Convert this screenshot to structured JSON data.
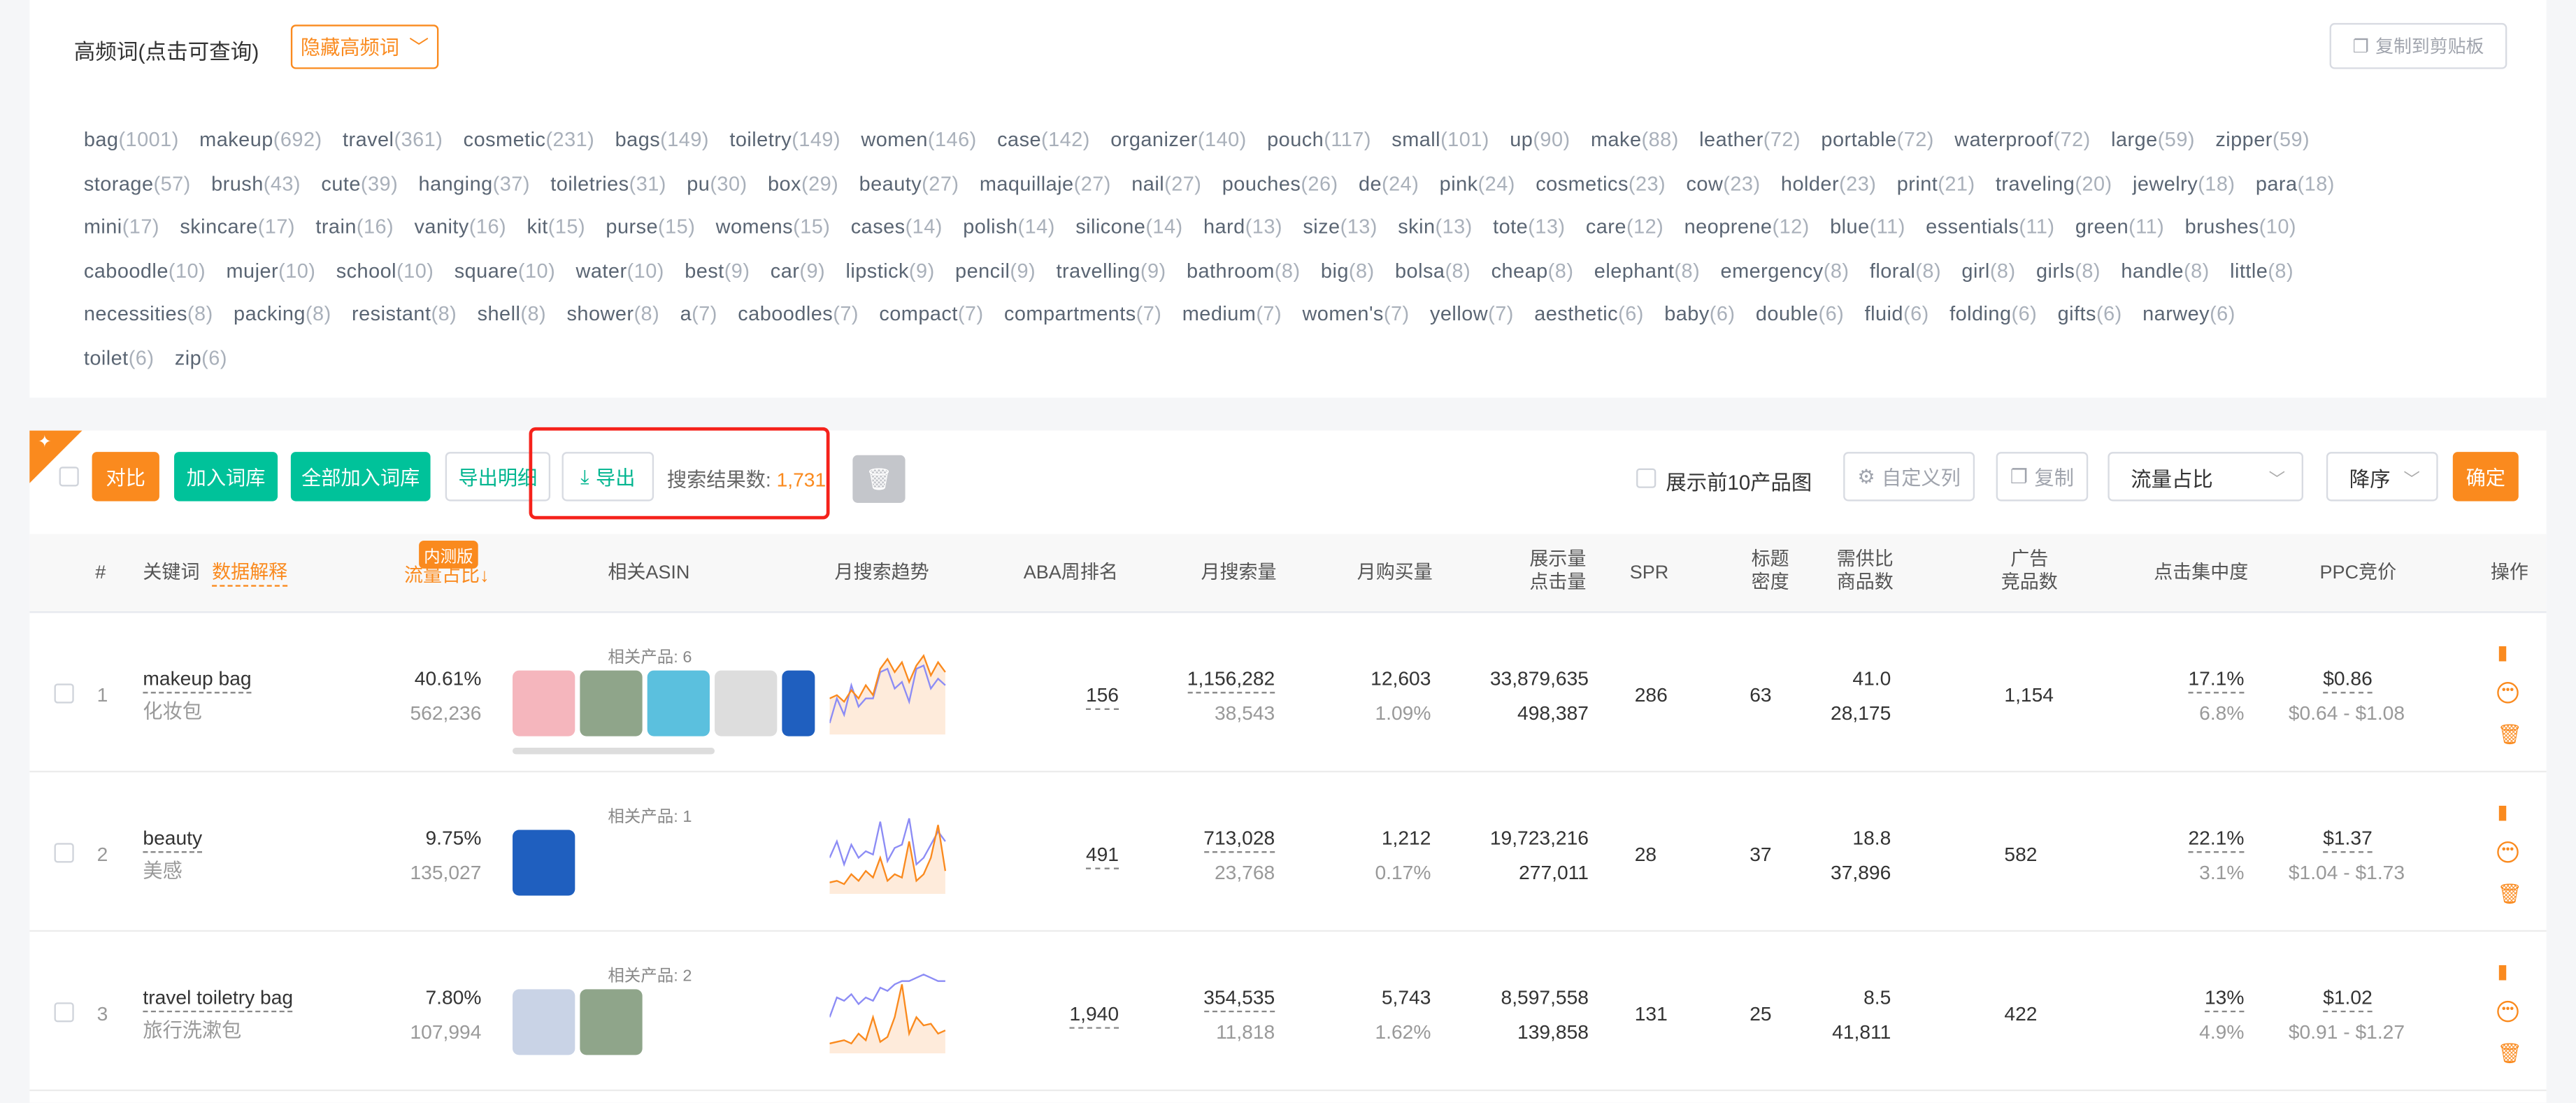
{
  "hf": {
    "title": "高频词(点击可查询)",
    "toggle_label": "隐藏高频词",
    "copy_label": "复制到剪贴板",
    "rows": [
      [
        [
          "bag",
          "1001"
        ],
        [
          "makeup",
          "692"
        ],
        [
          "travel",
          "361"
        ],
        [
          "cosmetic",
          "231"
        ],
        [
          "bags",
          "149"
        ],
        [
          "toiletry",
          "149"
        ],
        [
          "women",
          "146"
        ],
        [
          "case",
          "142"
        ],
        [
          "organizer",
          "140"
        ],
        [
          "pouch",
          "117"
        ],
        [
          "small",
          "101"
        ],
        [
          "up",
          "90"
        ],
        [
          "make",
          "88"
        ],
        [
          "leather",
          "72"
        ],
        [
          "portable",
          "72"
        ],
        [
          "waterproof",
          "72"
        ],
        [
          "large",
          "59"
        ],
        [
          "zipper",
          "59"
        ]
      ],
      [
        [
          "storage",
          "57"
        ],
        [
          "brush",
          "43"
        ],
        [
          "cute",
          "39"
        ],
        [
          "hanging",
          "37"
        ],
        [
          "toiletries",
          "31"
        ],
        [
          "pu",
          "30"
        ],
        [
          "box",
          "29"
        ],
        [
          "beauty",
          "27"
        ],
        [
          "maquillaje",
          "27"
        ],
        [
          "nail",
          "27"
        ],
        [
          "pouches",
          "26"
        ],
        [
          "de",
          "24"
        ],
        [
          "pink",
          "24"
        ],
        [
          "cosmetics",
          "23"
        ],
        [
          "cow",
          "23"
        ],
        [
          "holder",
          "23"
        ],
        [
          "print",
          "21"
        ],
        [
          "traveling",
          "20"
        ],
        [
          "jewelry",
          "18"
        ],
        [
          "para",
          "18"
        ]
      ],
      [
        [
          "mini",
          "17"
        ],
        [
          "skincare",
          "17"
        ],
        [
          "train",
          "16"
        ],
        [
          "vanity",
          "16"
        ],
        [
          "kit",
          "15"
        ],
        [
          "purse",
          "15"
        ],
        [
          "womens",
          "15"
        ],
        [
          "cases",
          "14"
        ],
        [
          "polish",
          "14"
        ],
        [
          "silicone",
          "14"
        ],
        [
          "hard",
          "13"
        ],
        [
          "size",
          "13"
        ],
        [
          "skin",
          "13"
        ],
        [
          "tote",
          "13"
        ],
        [
          "care",
          "12"
        ],
        [
          "neoprene",
          "12"
        ],
        [
          "blue",
          "11"
        ],
        [
          "essentials",
          "11"
        ],
        [
          "green",
          "11"
        ],
        [
          "brushes",
          "10"
        ]
      ],
      [
        [
          "caboodle",
          "10"
        ],
        [
          "mujer",
          "10"
        ],
        [
          "school",
          "10"
        ],
        [
          "square",
          "10"
        ],
        [
          "water",
          "10"
        ],
        [
          "best",
          "9"
        ],
        [
          "car",
          "9"
        ],
        [
          "lipstick",
          "9"
        ],
        [
          "pencil",
          "9"
        ],
        [
          "travelling",
          "9"
        ],
        [
          "bathroom",
          "8"
        ],
        [
          "big",
          "8"
        ],
        [
          "bolsa",
          "8"
        ],
        [
          "cheap",
          "8"
        ],
        [
          "elephant",
          "8"
        ],
        [
          "emergency",
          "8"
        ],
        [
          "floral",
          "8"
        ],
        [
          "girl",
          "8"
        ],
        [
          "girls",
          "8"
        ],
        [
          "handle",
          "8"
        ],
        [
          "little",
          "8"
        ]
      ],
      [
        [
          "necessities",
          "8"
        ],
        [
          "packing",
          "8"
        ],
        [
          "resistant",
          "8"
        ],
        [
          "shell",
          "8"
        ],
        [
          "shower",
          "8"
        ],
        [
          "a",
          "7"
        ],
        [
          "caboodles",
          "7"
        ],
        [
          "compact",
          "7"
        ],
        [
          "compartments",
          "7"
        ],
        [
          "medium",
          "7"
        ],
        [
          "women's",
          "7"
        ],
        [
          "yellow",
          "7"
        ],
        [
          "aesthetic",
          "6"
        ],
        [
          "baby",
          "6"
        ],
        [
          "double",
          "6"
        ],
        [
          "fluid",
          "6"
        ],
        [
          "folding",
          "6"
        ],
        [
          "gifts",
          "6"
        ],
        [
          "narwey",
          "6"
        ]
      ],
      [
        [
          "toilet",
          "6"
        ],
        [
          "zip",
          "6"
        ]
      ]
    ]
  },
  "toolbar": {
    "compare": "对比",
    "add_lib": "加入词库",
    "add_all": "全部加入词库",
    "export_detail": "导出明细",
    "export": "导出",
    "count_label": "搜索结果数:",
    "count": "1,731",
    "top10": "展示前10产品图",
    "custom_cols": "自定义列",
    "copy": "复制",
    "sort_field": "流量占比",
    "sort_order": "降序",
    "confirm": "确定"
  },
  "headers": {
    "idx": "#",
    "keyword": "关键词",
    "explain": "数据解释",
    "beta": "内测版",
    "flow": "流量占比↓",
    "asin": "相关ASIN",
    "trend": "月搜索趋势",
    "aba": "ABA周排名",
    "msearch": "月搜索量",
    "mbuy": "月购买量",
    "show1": "展示量",
    "show2": "点击量",
    "spr": "SPR",
    "td1": "标题",
    "td2": "密度",
    "ds1": "需供比",
    "ds2": "商品数",
    "ad1": "广告",
    "ad2": "竞品数",
    "click": "点击集中度",
    "ppc": "PPC竞价",
    "ops": "操作"
  },
  "rows": [
    {
      "idx": "1",
      "kw": "makeup bag",
      "kw_cn": "化妆包",
      "flow": "40.61%",
      "flow_n": "562,236",
      "rel": "相关产品: 6",
      "aba": "156",
      "ms": "1,156,282",
      "ms2": "38,543",
      "mb": "12,603",
      "mb2": "1.09%",
      "sh": "33,879,635",
      "cl": "498,387",
      "spr": "286",
      "td": "63",
      "ds": "41.0",
      "ds2": "28,175",
      "ad": "1,154",
      "cc": "17.1%",
      "cc2": "6.8%",
      "ppc": "$0.86",
      "ppc2": "$0.64 - $1.08"
    },
    {
      "idx": "2",
      "kw": "beauty",
      "kw_cn": "美感",
      "flow": "9.75%",
      "flow_n": "135,027",
      "rel": "相关产品: 1",
      "aba": "491",
      "ms": "713,028",
      "ms2": "23,768",
      "mb": "1,212",
      "mb2": "0.17%",
      "sh": "19,723,216",
      "cl": "277,011",
      "spr": "28",
      "td": "37",
      "ds": "18.8",
      "ds2": "37,896",
      "ad": "582",
      "cc": "22.1%",
      "cc2": "3.1%",
      "ppc": "$1.37",
      "ppc2": "$1.04 - $1.73"
    },
    {
      "idx": "3",
      "kw": "travel toiletry bag",
      "kw_cn": "旅行洗漱包",
      "flow": "7.80%",
      "flow_n": "107,994",
      "rel": "相关产品: 2",
      "aba": "1,940",
      "ms": "354,535",
      "ms2": "11,818",
      "mb": "5,743",
      "mb2": "1.62%",
      "sh": "8,597,558",
      "cl": "139,858",
      "spr": "131",
      "td": "25",
      "ds": "8.5",
      "ds2": "41,811",
      "ad": "422",
      "cc": "13%",
      "cc2": "4.9%",
      "ppc": "$1.02",
      "ppc2": "$0.91 - $1.27"
    }
  ],
  "colors": {
    "accent": "#fa8a1e",
    "green": "#00c29a",
    "highlight": "#f5221b",
    "trend_orange": "#fa8a1e",
    "trend_blue": "#8c8cf5"
  }
}
